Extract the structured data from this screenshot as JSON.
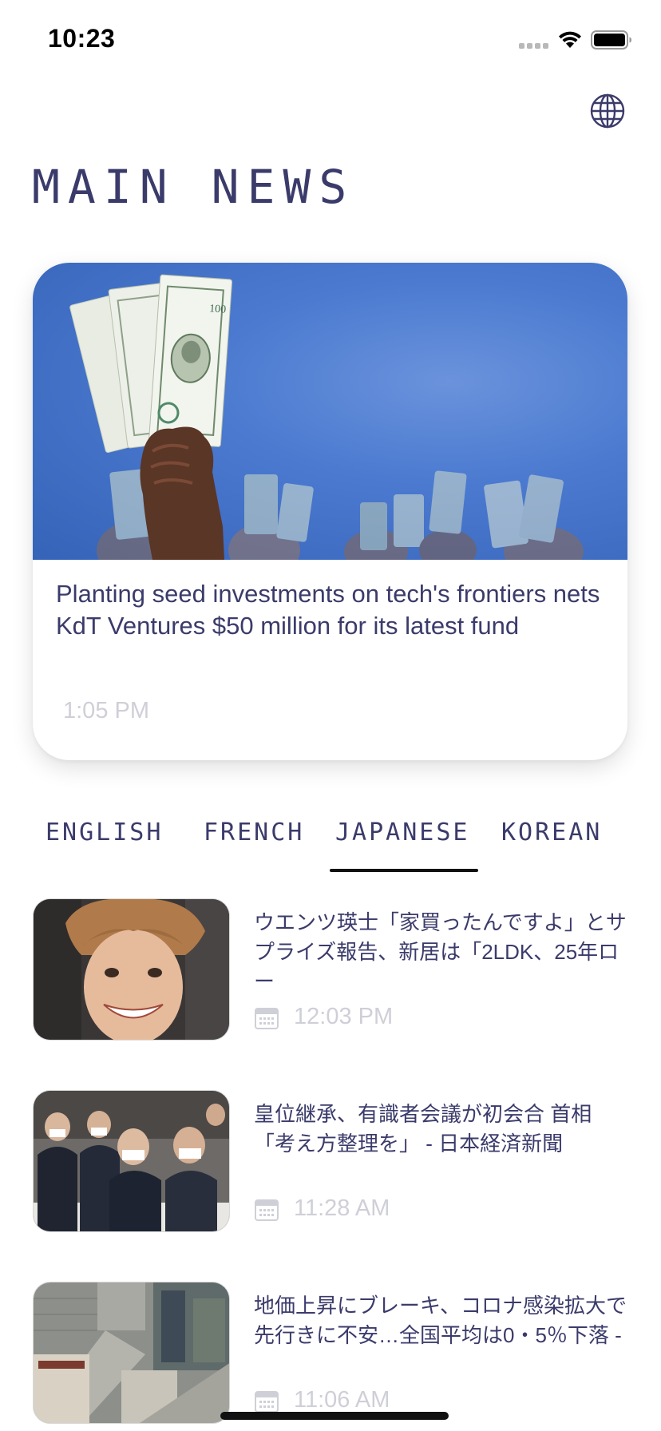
{
  "status_bar": {
    "time": "10:23"
  },
  "header": {
    "title": "MAIN NEWS",
    "globe_icon": "globe-icon"
  },
  "featured": {
    "title": "Planting seed investments on tech's frontiers nets KdT Ventures $50 million for its latest fund",
    "time": "1:05 PM"
  },
  "tabs": [
    {
      "label": "ENGLISH"
    },
    {
      "label": "FRENCH"
    },
    {
      "label": "JAPANESE",
      "active": true
    },
    {
      "label": "KOREAN"
    }
  ],
  "news": [
    {
      "title": "ウエンツ瑛士「家買ったんですよ」とサプライズ報告、新居は「2LDK、25年ロー",
      "time": "12:03 PM"
    },
    {
      "title": "皇位継承、有識者会議が初会合 首相「考え方整理を」 - 日本経済新聞",
      "time": "11:28 AM"
    },
    {
      "title": "地価上昇にブレーキ、コロナ感染拡大で先行きに不安…全国平均は0・5％下落 -",
      "time": "11:06 AM"
    }
  ],
  "colors": {
    "text": "#3b3b6b",
    "muted": "#cfcfd8",
    "indicator": "#111111"
  }
}
